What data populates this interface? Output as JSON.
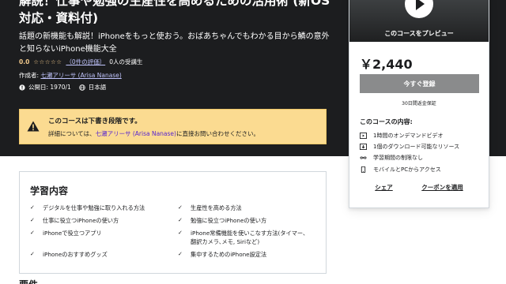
{
  "hero": {
    "title": "解説！仕事や勉強の生産性を高めるための活用術 (新OS対応・資料付)",
    "subtitle": "話題の新機能も解説！iPhoneをもっと使おう。おばあちゃんでもわかる目から鱗の意外と知らないiPhone機能大全",
    "rating_value": "0.0",
    "stars": "☆☆☆☆☆",
    "reviews_text": "（0件の評価）",
    "students_text": "0人の受講生",
    "author_prefix": "作成者:",
    "author_name": "七瀬アリーサ (Arisa Nanase)",
    "published": "公開日: 1970/1",
    "language": "日本語"
  },
  "notice": {
    "title": "このコースは下書き段階です。",
    "body_prefix": "詳細については、",
    "body_link": "七瀬アリーサ (Arisa Nanase)",
    "body_suffix": "に直接お問い合わせください。"
  },
  "learn": {
    "title": "学習内容",
    "items": [
      "デジタルを仕事や勉強に取り入れる方法",
      "生産性を高める方法",
      "仕事に役立つiPhoneの使い方",
      "勉強に役立つiPhoneの使い方",
      "iPhoneで役立つアプリ",
      "iPhone常備機能を使いこなす方法(タイマー、翻訳カメラ､メモ, Siriなど)",
      "iPhoneのおすすめグッズ",
      "集中するためのiPhone設定法"
    ]
  },
  "requirements_title": "要件",
  "sidebar": {
    "preview_label": "このコースをプレビュー",
    "price": "￥2,440",
    "enroll_label": "今すぐ登録",
    "guarantee": "30日間返金保証",
    "includes_title": "このコースの内容:",
    "includes": [
      {
        "icon": "video-icon",
        "text": "1時間のオンデマンドビデオ"
      },
      {
        "icon": "download-icon",
        "text": "1個のダウンロード可能なリソース"
      },
      {
        "icon": "infinity-icon",
        "text": "学習期間の制限なし"
      },
      {
        "icon": "mobile-icon",
        "text": "モバイルとPCからアクセス"
      }
    ],
    "share_label": "シェア",
    "coupon_label": "クーポンを適用"
  }
}
